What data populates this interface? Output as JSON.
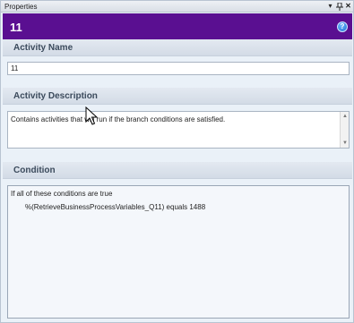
{
  "window": {
    "title": "Properties",
    "pin_glyph": "▾",
    "dock_glyph": "⦀",
    "close_glyph": "✕"
  },
  "header": {
    "title": "11",
    "help_glyph": "?"
  },
  "sections": {
    "activity_name": {
      "label": "Activity Name",
      "value": "11"
    },
    "activity_description": {
      "label": "Activity Description",
      "value": "Contains activities that will run if the branch conditions are satisfied."
    },
    "condition": {
      "label": "Condition",
      "line1": "If all of these conditions are true",
      "line2": "%(RetrieveBusinessProcessVariables_Q11) equals 1488"
    }
  },
  "scrollbar": {
    "up_glyph": "▲",
    "down_glyph": "▼"
  },
  "colors": {
    "header_bg": "#5a0f91",
    "panel_bg": "#eaf1f8"
  }
}
